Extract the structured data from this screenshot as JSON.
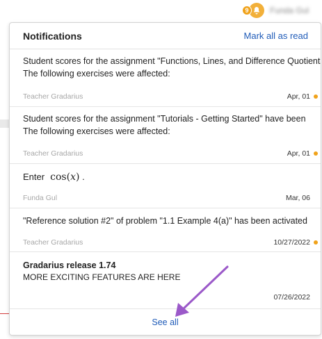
{
  "topbar": {
    "notification_count": "9",
    "user_name": "Funda Gul"
  },
  "panel": {
    "title": "Notifications",
    "mark_all_read": "Mark all as read",
    "see_all": "See all"
  },
  "notifications": [
    {
      "line1": "Student scores for the assignment \"Functions, Lines, and Difference Quotients\" have been",
      "line2": "The following exercises were affected:",
      "author": "Teacher Gradarius",
      "date": "Apr, 01",
      "unread": true
    },
    {
      "line1": "Student scores for the assignment \"Tutorials - Getting Started\" have been",
      "line2": "The following exercises were affected:",
      "author": "Teacher Gradarius",
      "date": "Apr, 01",
      "unread": true
    },
    {
      "prefix": "Enter",
      "math_fn": "cos",
      "math_var": "x",
      "suffix": ".",
      "author": "Funda Gul",
      "date": "Mar, 06",
      "unread": false
    },
    {
      "line1": "\"Reference solution #2\" of problem \"1.1 Example 4(a)\" has been activated",
      "author": "Teacher Gradarius",
      "date": "10/27/2022",
      "unread": true
    },
    {
      "title": "Gradarius release 1.74",
      "subtitle": "MORE EXCITING FEATURES ARE HERE",
      "date": "07/26/2022",
      "unread": false
    }
  ],
  "colors": {
    "accent_link": "#1f5bb8",
    "unread_dot": "#f0a21a",
    "annotation_arrow": "#9b59c9"
  }
}
